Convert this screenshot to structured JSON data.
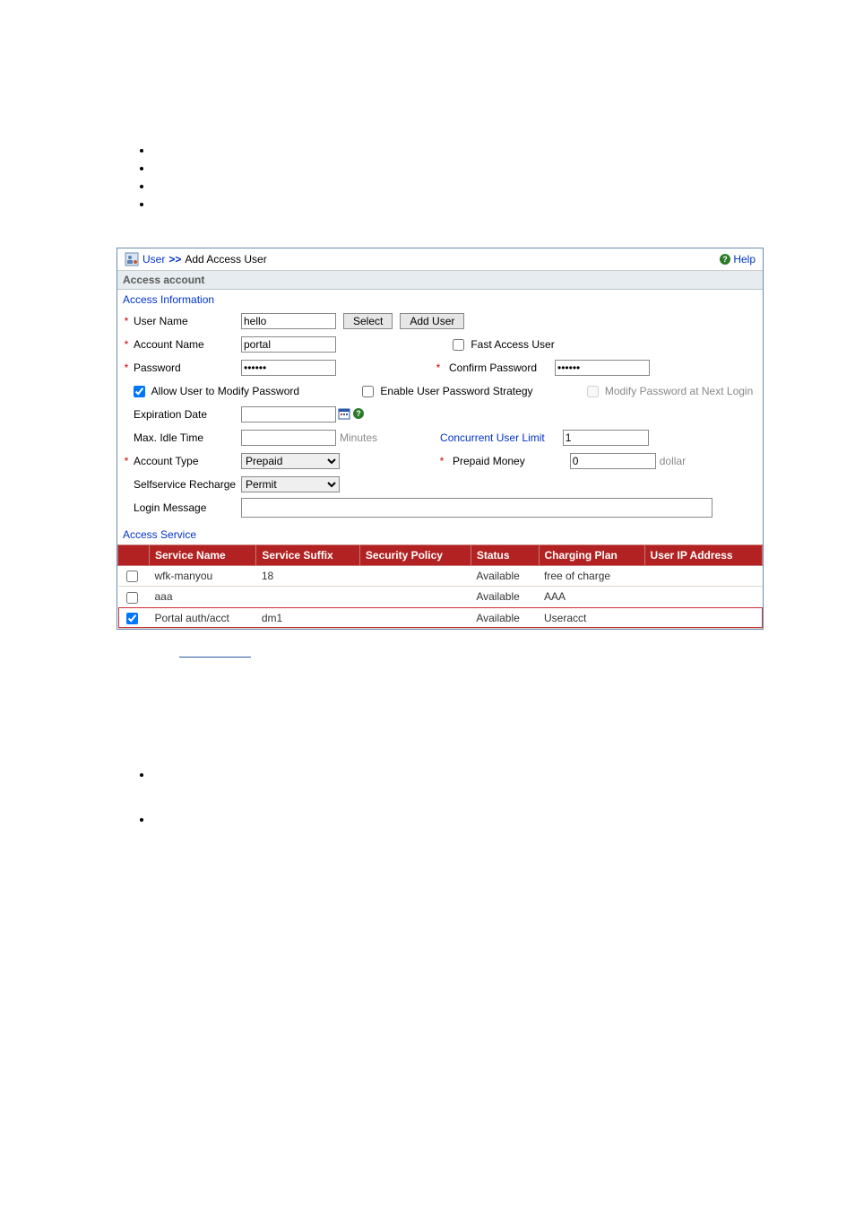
{
  "breadcrumb": {
    "root": "User",
    "sep": ">>",
    "current": "Add Access User"
  },
  "help_label": "Help",
  "section_title": "Access account",
  "subsection_info": "Access Information",
  "labels": {
    "user_name": "User Name",
    "account_name": "Account Name",
    "password": "Password",
    "confirm_password": "Confirm Password",
    "allow_modify": "Allow User to Modify Password",
    "enable_strategy": "Enable User Password Strategy",
    "modify_next": "Modify Password at Next Login",
    "expiration": "Expiration Date",
    "max_idle": "Max. Idle Time",
    "minutes": "Minutes",
    "concurrent": "Concurrent User Limit",
    "account_type": "Account Type",
    "prepaid_money": "Prepaid Money",
    "dollar": "dollar",
    "selfservice": "Selfservice Recharge",
    "login_msg": "Login Message",
    "fast_access": "Fast Access User"
  },
  "values": {
    "user_name": "hello",
    "account_name": "portal",
    "password": "••••••",
    "confirm_password": "••••••",
    "concurrent": "1",
    "prepaid_money": "0",
    "account_type": "Prepaid",
    "selfservice": "Permit",
    "allow_modify_checked": true,
    "enable_strategy_checked": false,
    "modify_next_checked": false,
    "fast_access_checked": false
  },
  "buttons": {
    "select": "Select",
    "add_user": "Add User"
  },
  "subsection_service": "Access Service",
  "table": {
    "headers": {
      "service_name": "Service Name",
      "service_suffix": "Service Suffix",
      "security_policy": "Security Policy",
      "status": "Status",
      "charging_plan": "Charging Plan",
      "user_ip": "User IP Address"
    },
    "rows": [
      {
        "checked": false,
        "name": "wfk-manyou",
        "suffix": "18",
        "policy": "",
        "status": "Available",
        "plan": "free of charge",
        "ip": ""
      },
      {
        "checked": false,
        "name": "aaa",
        "suffix": "",
        "policy": "",
        "status": "Available",
        "plan": "AAA",
        "ip": ""
      },
      {
        "checked": true,
        "name": "Portal auth/acct",
        "suffix": "dm1",
        "policy": "",
        "status": "Available",
        "plan": "Useracct",
        "ip": ""
      }
    ]
  }
}
